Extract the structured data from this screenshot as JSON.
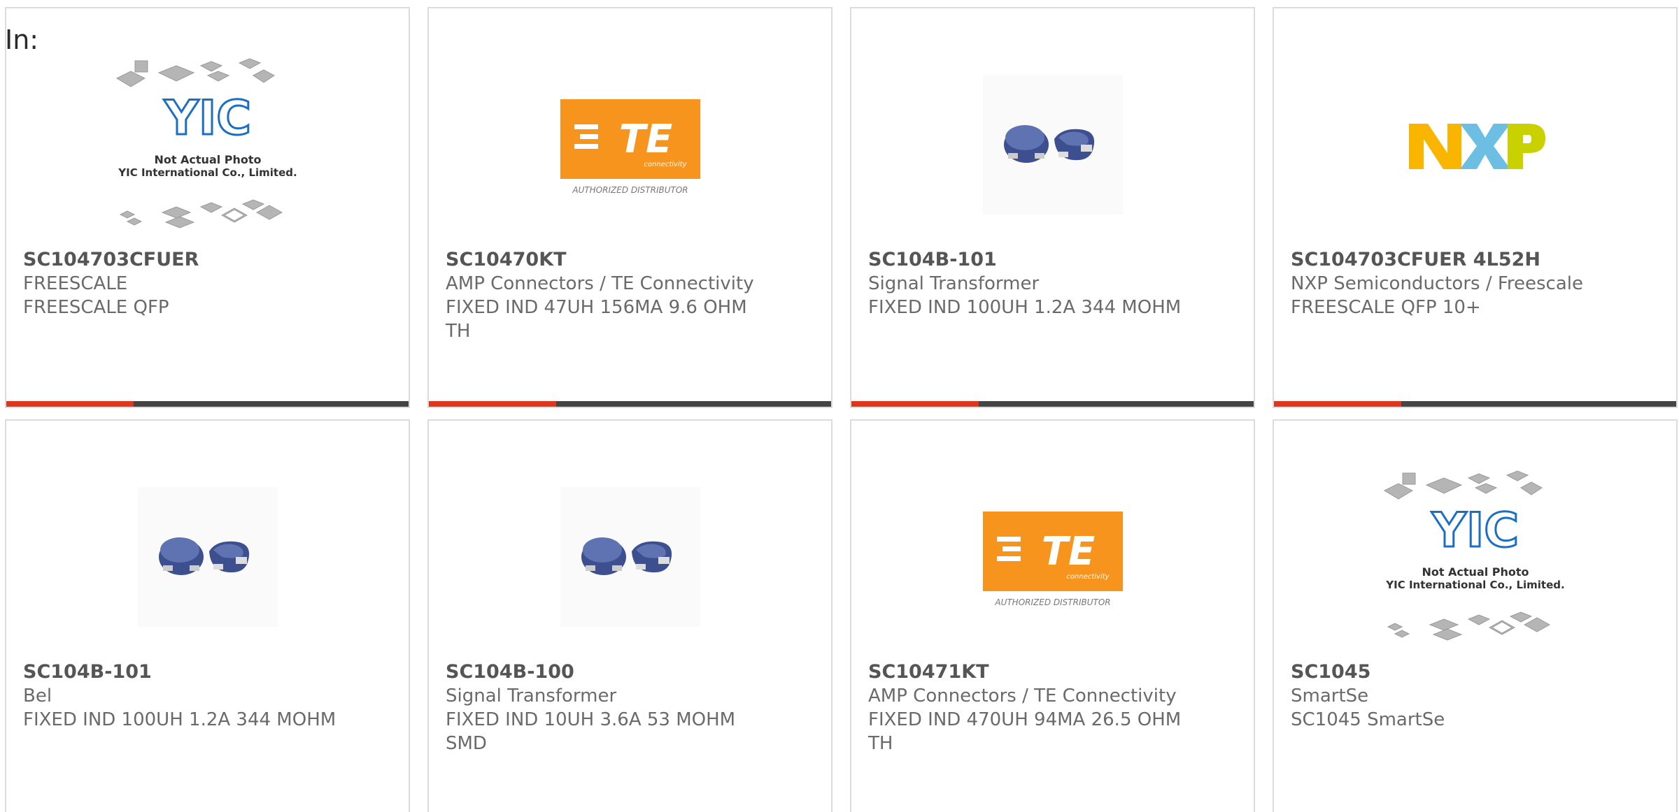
{
  "header": {
    "in_label": "In:"
  },
  "colors": {
    "accent": "#e0361b",
    "bar": "#444444",
    "te_orange": "#f7941d"
  },
  "placeholder_text": {
    "line1": "Not Actual Photo",
    "line2": "YIC International Co., Limited.",
    "logo": "YIC"
  },
  "te_logo": {
    "brand": "TE",
    "sub": "connectivity",
    "caption": "AUTHORIZED DISTRIBUTOR"
  },
  "nxp_logo": {
    "text": "NXP"
  },
  "cards": [
    {
      "pn": "SC104703CFUER",
      "mfr": "FREESCALE",
      "desc": "FREESCALE QFP",
      "image": "yic-placeholder"
    },
    {
      "pn": "SC10470KT",
      "mfr": "AMP Connectors / TE Connectivity",
      "desc": "FIXED IND 47UH 156MA 9.6 OHM TH",
      "image": "te-logo"
    },
    {
      "pn": "SC104B-101",
      "mfr": "Signal Transformer",
      "desc": "FIXED IND 100UH 1.2A 344 MOHM",
      "image": "inductor-photo"
    },
    {
      "pn": "SC104703CFUER 4L52H",
      "mfr": "NXP Semiconductors / Freescale",
      "desc": "FREESCALE QFP 10+",
      "image": "nxp-logo"
    },
    {
      "pn": "SC104B-101",
      "mfr": "Bel",
      "desc": "FIXED IND 100UH 1.2A 344 MOHM",
      "image": "inductor-photo"
    },
    {
      "pn": "SC104B-100",
      "mfr": "Signal Transformer",
      "desc": "FIXED IND 10UH 3.6A 53 MOHM SMD",
      "image": "inductor-photo"
    },
    {
      "pn": "SC10471KT",
      "mfr": "AMP Connectors / TE Connectivity",
      "desc": "FIXED IND 470UH 94MA 26.5 OHM TH",
      "image": "te-logo"
    },
    {
      "pn": "SC1045",
      "mfr": "SmartSe",
      "desc": "SC1045 SmartSe",
      "image": "yic-placeholder"
    }
  ]
}
